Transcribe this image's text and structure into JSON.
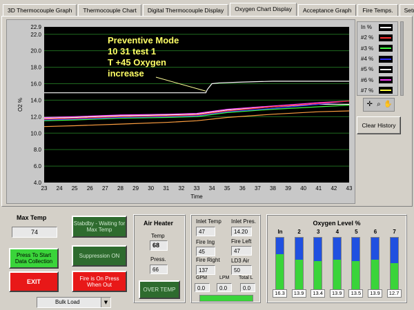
{
  "tabs": [
    {
      "label": "3D Thermocouple Graph"
    },
    {
      "label": "Thermocouple Chart"
    },
    {
      "label": "Digital Thermocouple Display"
    },
    {
      "label": "Oxygen Chart Display",
      "active": true
    },
    {
      "label": "Acceptance Graph"
    },
    {
      "label": "Fire Temps."
    },
    {
      "label": "Setup"
    }
  ],
  "legend": [
    {
      "label": "In %",
      "color": "#ffffff"
    },
    {
      "label": "#2 %",
      "color": "#ff3030"
    },
    {
      "label": "#3 %",
      "color": "#40ff40"
    },
    {
      "label": "#4 %",
      "color": "#3030ff"
    },
    {
      "label": "#5 %",
      "color": "#ffffff"
    },
    {
      "label": "#6 %",
      "color": "#ff40ff"
    },
    {
      "label": "#7 %",
      "color": "#ffff40"
    }
  ],
  "palette_icons": [
    "crosshair-icon",
    "zoom-icon",
    "hand-icon"
  ],
  "clear_history_label": "Clear History",
  "chart_data": {
    "type": "line",
    "xlabel": "Time",
    "ylabel": "O2 %",
    "xlim": [
      23,
      43
    ],
    "ylim": [
      4.0,
      22.9
    ],
    "xticks": [
      "23",
      "24",
      "25",
      "26",
      "27",
      "28",
      "29",
      "30",
      "31",
      "32",
      "33",
      "34",
      "35",
      "36",
      "37",
      "38",
      "39",
      "40",
      "41",
      "42",
      "43"
    ],
    "yticks": [
      "22.9",
      "22.0",
      "20.0",
      "18.0",
      "16.0",
      "14.0",
      "12.0",
      "10.0",
      "8.0",
      "6.0",
      "4.0"
    ],
    "annotation": [
      "Preventive Mode",
      "10 31 test 1",
      "T +45 Oxygen",
      "increase"
    ],
    "grid": true,
    "series": [
      {
        "name": "In %",
        "color": "#ffffff",
        "x": [
          23,
          33.6,
          33.7,
          34,
          34.5,
          36,
          38,
          40,
          43
        ],
        "y": [
          14.9,
          14.9,
          15.3,
          16.0,
          16.1,
          16.2,
          16.3,
          16.3,
          16.3
        ]
      },
      {
        "name": "#2 %",
        "color": "#ff3030",
        "x": [
          23,
          25,
          28,
          31,
          33,
          35,
          38,
          41,
          43
        ],
        "y": [
          11.7,
          11.8,
          12.0,
          12.1,
          12.2,
          12.7,
          13.2,
          13.6,
          13.9
        ]
      },
      {
        "name": "#3 %",
        "color": "#40ff40",
        "x": [
          23,
          25,
          28,
          31,
          33,
          35,
          38,
          41,
          43
        ],
        "y": [
          11.5,
          11.6,
          11.8,
          11.9,
          12.0,
          12.5,
          12.9,
          13.2,
          13.4
        ]
      },
      {
        "name": "#4 %",
        "color": "#3030ff",
        "x": [
          23,
          25,
          28,
          31,
          33,
          35,
          38,
          41,
          43
        ],
        "y": [
          11.6,
          11.7,
          11.9,
          12.0,
          12.1,
          12.6,
          13.0,
          13.5,
          13.9
        ]
      },
      {
        "name": "#5 %",
        "color": "#ffffff",
        "x": [
          23,
          25,
          28,
          31,
          33,
          35,
          38,
          41,
          43
        ],
        "y": [
          11.8,
          11.9,
          12.1,
          12.2,
          12.3,
          12.8,
          13.2,
          13.5,
          13.5
        ]
      },
      {
        "name": "#6 %",
        "color": "#ff40ff",
        "x": [
          23,
          25,
          28,
          31,
          33,
          35,
          38,
          41,
          43
        ],
        "y": [
          11.9,
          12.0,
          12.2,
          12.3,
          12.4,
          12.9,
          13.3,
          13.7,
          13.9
        ]
      },
      {
        "name": "#7 %",
        "color": "#ffa040",
        "x": [
          23,
          25,
          28,
          31,
          33,
          35,
          38,
          41,
          43
        ],
        "y": [
          10.8,
          10.9,
          11.1,
          11.3,
          11.5,
          11.9,
          12.3,
          12.6,
          12.7
        ]
      }
    ]
  },
  "controls": {
    "max_temp_title": "Max Temp",
    "max_temp_value": "74",
    "start_label": "Press To Start Data Collection",
    "exit_label": "EXIT",
    "standby_label": "Stabdby - Waiting for Max Temp",
    "suppression_label": "Suppression ON",
    "fire_label": "Fire is On Press When Out",
    "bulk_load_value": "Bulk Load"
  },
  "air_heater": {
    "title": "Air Heater",
    "temp_label": "Temp",
    "temp_value": "68",
    "press_label": "Press.",
    "press_value": "66",
    "over_temp_label": "OVER TEMP"
  },
  "flow": {
    "inlet_temp_label": "Inlet Temp",
    "inlet_temp_value": "47",
    "inlet_pres_label": "Inlet Pres.",
    "inlet_pres_value": "14.20",
    "fire_ing_label": "Fire Ing",
    "fire_ing_value": "45",
    "fire_left_label": "Fire Left",
    "fire_left_value": "47",
    "fire_right_label": "Fire Right",
    "fire_right_value": "137",
    "ld3_air_label": "LD3 Air",
    "ld3_air_value": "50",
    "gpm_label": "GPM",
    "gpm_value": "0.0",
    "lpm_label": "LPM",
    "lpm_value": "0.0",
    "total_label": "Total L",
    "total_value": "0.0"
  },
  "oxygen_level": {
    "title": "Oxygen Level %",
    "max": 22.9,
    "bars": [
      {
        "label": "In",
        "value": "16.3"
      },
      {
        "label": "2",
        "value": "13.9"
      },
      {
        "label": "3",
        "value": "13.4"
      },
      {
        "label": "4",
        "value": "13.9"
      },
      {
        "label": "5",
        "value": "13.5"
      },
      {
        "label": "6",
        "value": "13.9"
      },
      {
        "label": "7",
        "value": "12.7"
      }
    ]
  }
}
